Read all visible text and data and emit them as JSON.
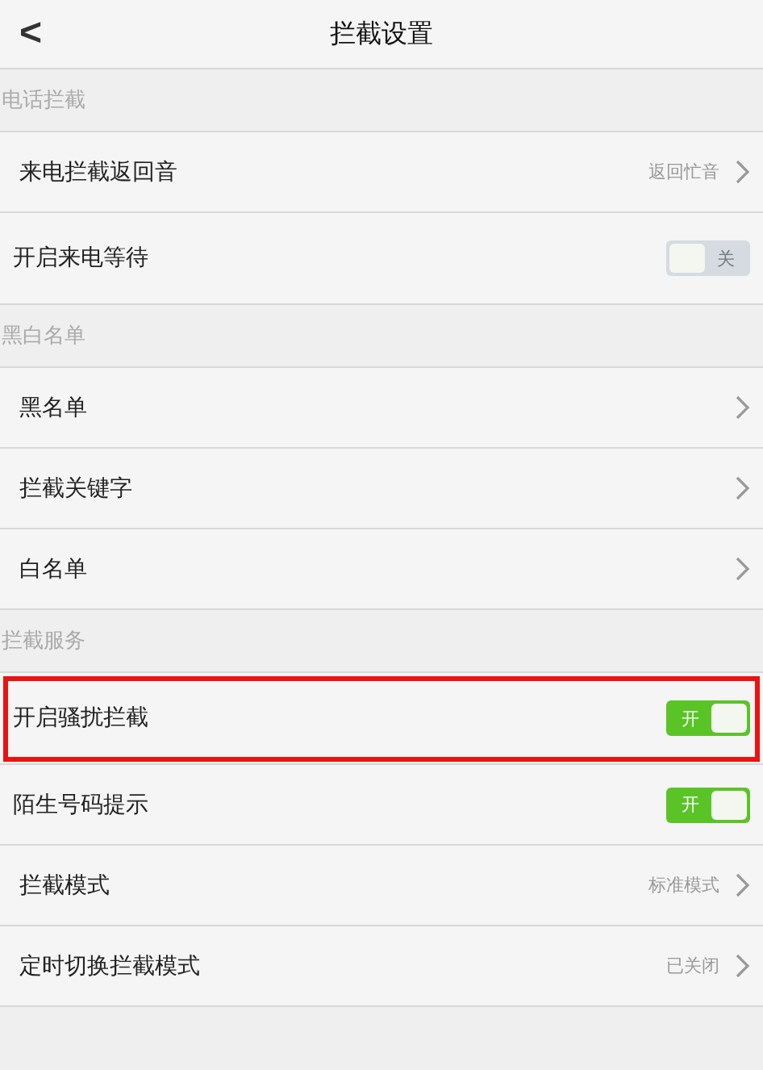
{
  "header": {
    "back": "<",
    "title": "拦截设置"
  },
  "sections": [
    {
      "title": "电话拦截",
      "items": [
        {
          "kind": "link",
          "label": "来电拦截返回音",
          "value": "返回忙音",
          "highlighted": false
        },
        {
          "kind": "toggle",
          "label": "开启来电等待",
          "on": false,
          "switch_text": "关",
          "highlighted": false
        }
      ]
    },
    {
      "title": "黑白名单",
      "items": [
        {
          "kind": "link",
          "label": "黑名单",
          "highlighted": false
        },
        {
          "kind": "link",
          "label": "拦截关键字",
          "highlighted": false
        },
        {
          "kind": "link",
          "label": "白名单",
          "highlighted": false
        }
      ]
    },
    {
      "title": "拦截服务",
      "items": [
        {
          "kind": "toggle",
          "label": "开启骚扰拦截",
          "on": true,
          "switch_text": "开",
          "highlighted": true
        },
        {
          "kind": "toggle",
          "label": "陌生号码提示",
          "on": true,
          "switch_text": "开",
          "highlighted": false
        },
        {
          "kind": "link",
          "label": "拦截模式",
          "value": "标准模式",
          "highlighted": false
        },
        {
          "kind": "link",
          "label": "定时切换拦截模式",
          "value": "已关闭",
          "highlighted": false
        }
      ]
    }
  ]
}
